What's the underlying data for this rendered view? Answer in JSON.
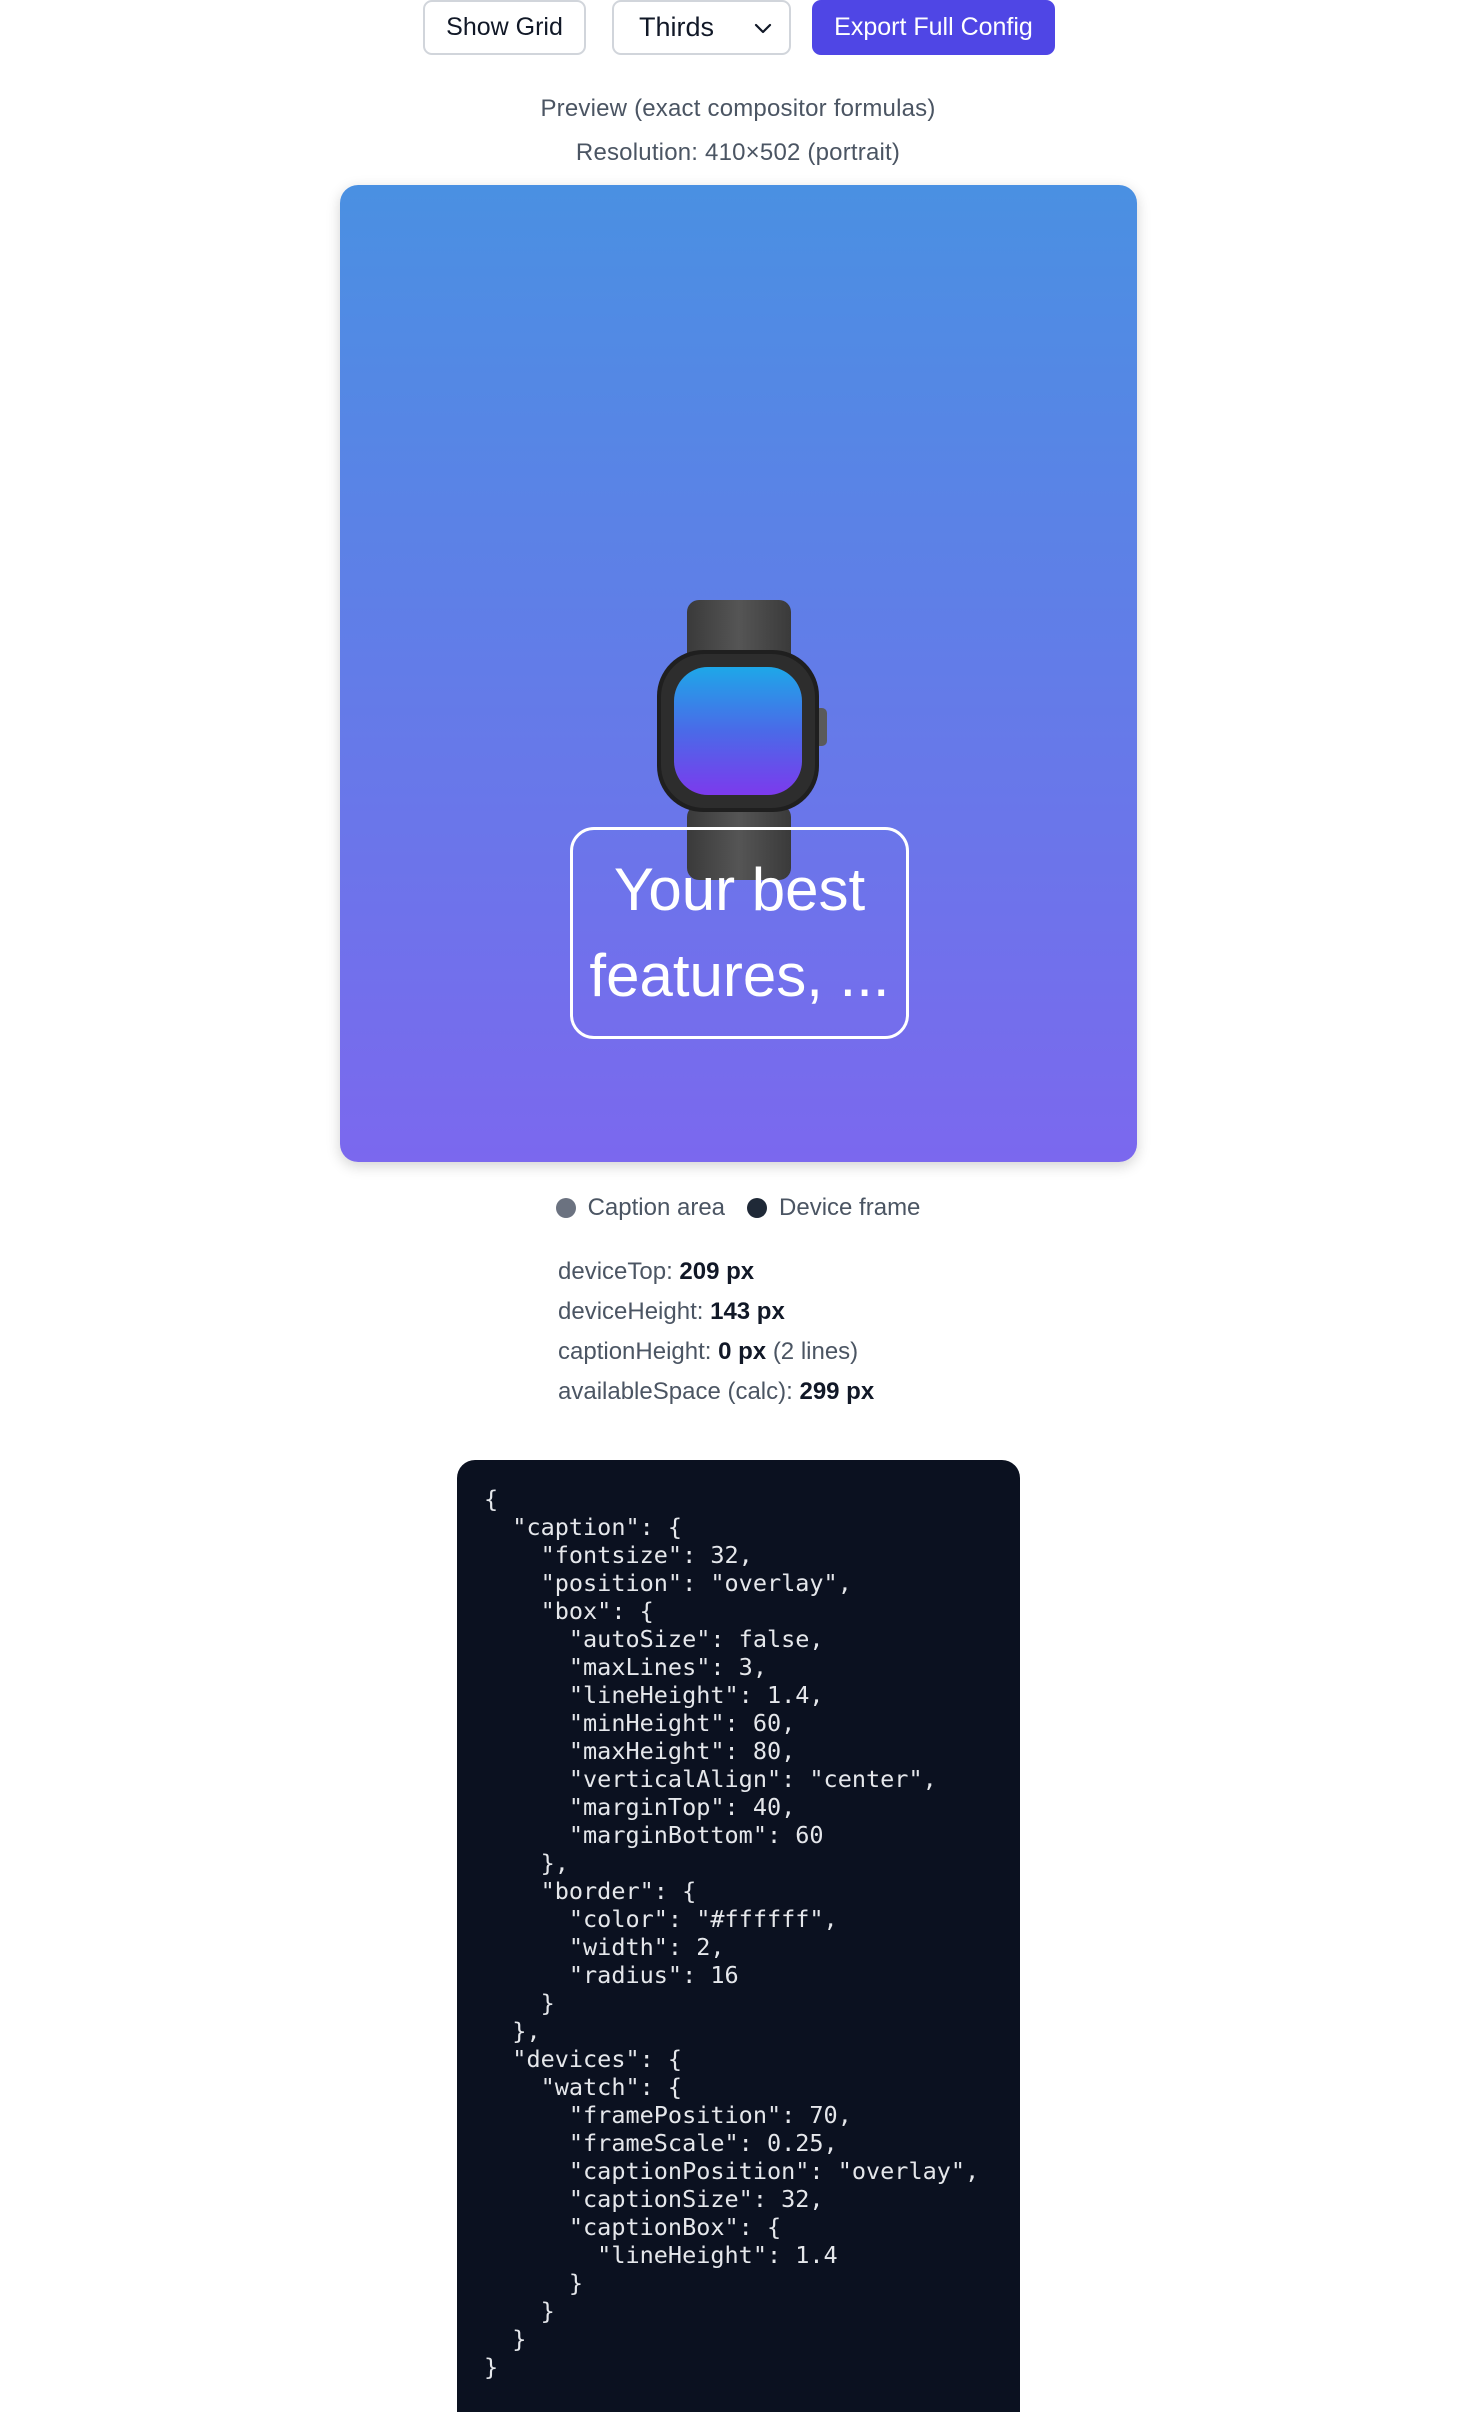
{
  "toolbar": {
    "show_grid_label": "Show Grid",
    "grid_mode_value": "Thirds",
    "export_label": "Export Full Config"
  },
  "preview": {
    "title": "Preview (exact compositor formulas)",
    "resolution": "Resolution: 410×502 (portrait)",
    "gradient_top": "#4a90e2",
    "gradient_bottom": "#7b68ee",
    "caption_line1": "Your best",
    "caption_line2": "features, ..."
  },
  "legend": {
    "caption_area": "Caption area",
    "device_frame": "Device frame"
  },
  "metrics": {
    "device_top_label": "deviceTop:",
    "device_top_value": "209 px",
    "device_height_label": "deviceHeight:",
    "device_height_value": "143 px",
    "caption_height_label": "captionHeight:",
    "caption_height_value": "0 px",
    "caption_height_note": "(2 lines)",
    "available_space_label": "availableSpace (calc):",
    "available_space_value": "299 px"
  },
  "config_json": "{\n  \"caption\": {\n    \"fontsize\": 32,\n    \"position\": \"overlay\",\n    \"box\": {\n      \"autoSize\": false,\n      \"maxLines\": 3,\n      \"lineHeight\": 1.4,\n      \"minHeight\": 60,\n      \"maxHeight\": 80,\n      \"verticalAlign\": \"center\",\n      \"marginTop\": 40,\n      \"marginBottom\": 60\n    },\n    \"border\": {\n      \"color\": \"#ffffff\",\n      \"width\": 2,\n      \"radius\": 16\n    }\n  },\n  \"devices\": {\n    \"watch\": {\n      \"framePosition\": 70,\n      \"frameScale\": 0.25,\n      \"captionPosition\": \"overlay\",\n      \"captionSize\": 32,\n      \"captionBox\": {\n        \"lineHeight\": 1.4\n      }\n    }\n  }\n}"
}
